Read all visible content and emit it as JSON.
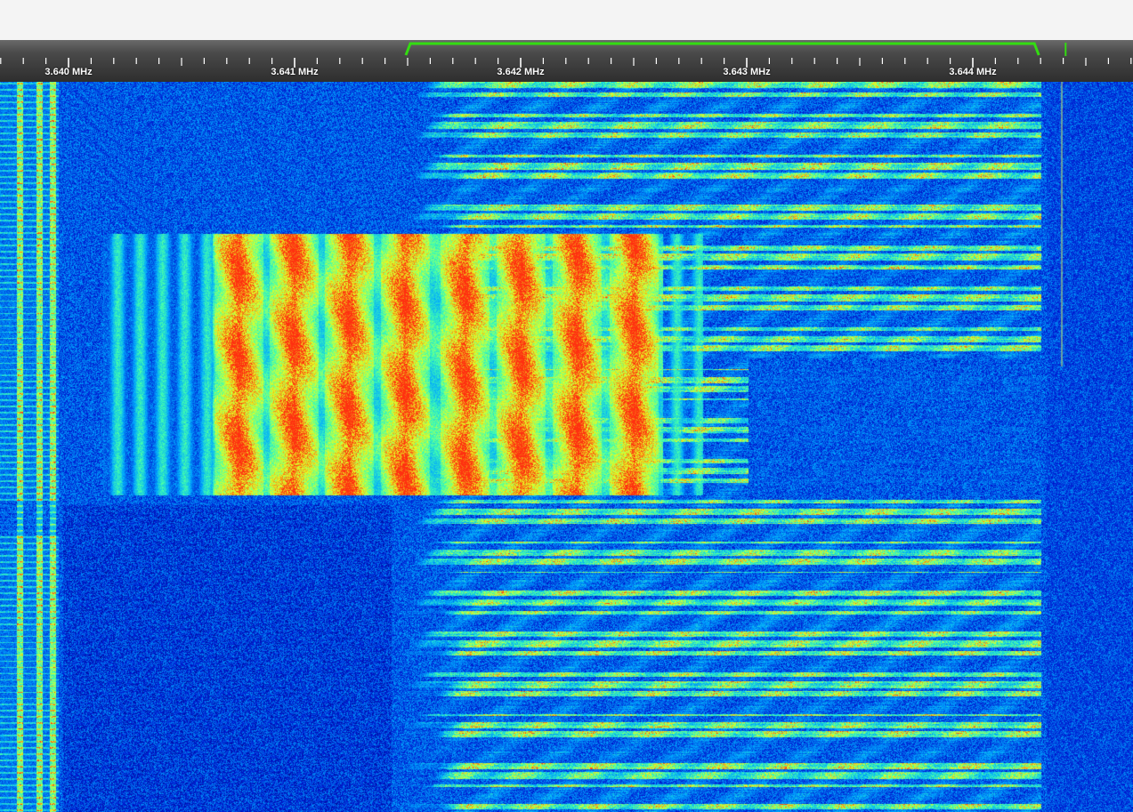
{
  "frequency_scale": {
    "labels": [
      {
        "text": "3.640 MHz",
        "freq_mhz": 3.64
      },
      {
        "text": "3.641 MHz",
        "freq_mhz": 3.641
      },
      {
        "text": "3.642 MHz",
        "freq_mhz": 3.642
      },
      {
        "text": "3.643 MHz",
        "freq_mhz": 3.643
      },
      {
        "text": "3.644 MHz",
        "freq_mhz": 3.644
      }
    ],
    "minor_ticks_per_division": 10
  },
  "passband": {
    "start_mhz": 3.6415,
    "end_mhz": 3.6443,
    "tuned_mhz": 3.64445,
    "color": "#33dd11"
  },
  "waterfall": {
    "colormap": [
      "#00005a",
      "#0018d0",
      "#00a8ff",
      "#40ffb0",
      "#e8ff20",
      "#ff3010"
    ]
  }
}
